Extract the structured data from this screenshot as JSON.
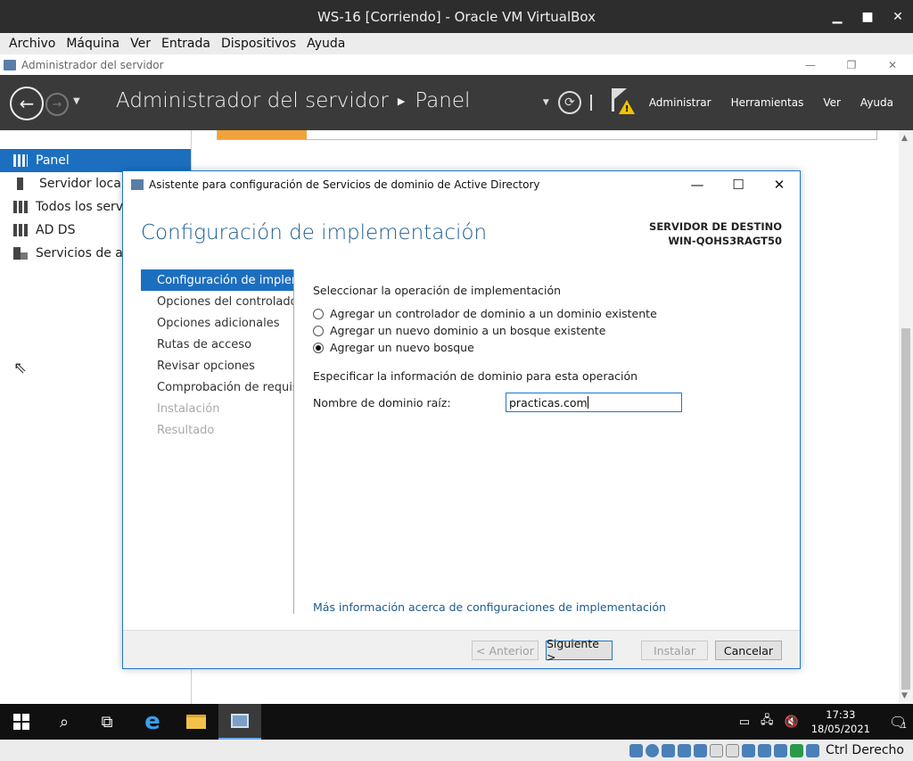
{
  "vbox": {
    "title": "WS-16 [Corriendo] - Oracle VM VirtualBox",
    "menu": [
      "Archivo",
      "Máquina",
      "Ver",
      "Entrada",
      "Dispositivos",
      "Ayuda"
    ],
    "host_key": "Ctrl Derecho"
  },
  "server_manager": {
    "window_title": "Administrador del servidor",
    "breadcrumb": {
      "root": "Administrador del servidor",
      "current": "Panel"
    },
    "header_menu": [
      "Administrar",
      "Herramientas",
      "Ver",
      "Ayuda"
    ],
    "sidebar": [
      {
        "label": "Panel",
        "icon": "dashboard-icon",
        "active": true
      },
      {
        "label": "Servidor local",
        "icon": "server-icon",
        "active": false
      },
      {
        "label": "Todos los servid",
        "icon": "servers-icon",
        "active": false
      },
      {
        "label": "AD DS",
        "icon": "ad-ds-icon",
        "active": false
      },
      {
        "label": "Servicios de arc",
        "icon": "file-services-icon",
        "active": false
      }
    ]
  },
  "wizard": {
    "title": "Asistente para configuración de Servicios de dominio de Active Directory",
    "heading": "Configuración de implementación",
    "dest_label": "SERVIDOR DE DESTINO",
    "dest_server": "WIN-QOHS3RAGT50",
    "steps": [
      {
        "label": "Configuración de implem...",
        "state": "active"
      },
      {
        "label": "Opciones del controlador...",
        "state": "normal"
      },
      {
        "label": "Opciones adicionales",
        "state": "normal"
      },
      {
        "label": "Rutas de acceso",
        "state": "normal"
      },
      {
        "label": "Revisar opciones",
        "state": "normal"
      },
      {
        "label": "Comprobación de requisi...",
        "state": "normal"
      },
      {
        "label": "Instalación",
        "state": "disabled"
      },
      {
        "label": "Resultado",
        "state": "disabled"
      }
    ],
    "operation_label": "Seleccionar la operación de implementación",
    "options": [
      {
        "label": "Agregar un controlador de dominio a un dominio existente",
        "selected": false
      },
      {
        "label": "Agregar un nuevo dominio a un bosque existente",
        "selected": false
      },
      {
        "label": "Agregar un nuevo bosque",
        "selected": true
      }
    ],
    "domain_info_label": "Especificar la información de dominio para esta operación",
    "root_domain_label": "Nombre de dominio raíz:",
    "root_domain_value": "practicas.com",
    "more_info_link": "Más información acerca de configuraciones de implementación",
    "buttons": {
      "previous": "< Anterior",
      "next": "Siguiente >",
      "install": "Instalar",
      "cancel": "Cancelar"
    }
  },
  "taskbar": {
    "time": "17:33",
    "date": "18/05/2021",
    "notification_count": "1"
  }
}
